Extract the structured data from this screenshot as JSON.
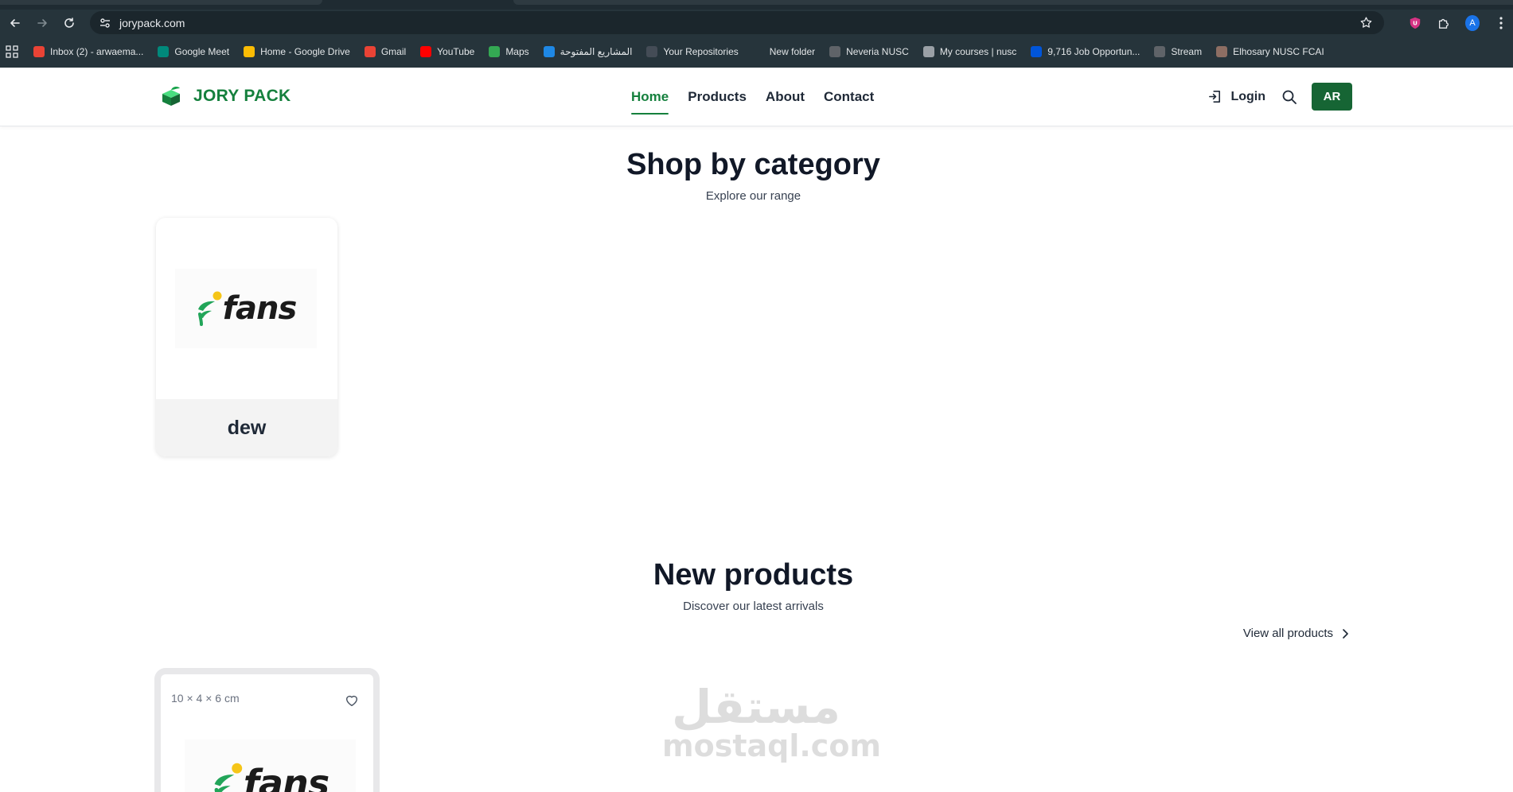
{
  "browser": {
    "url": "jorypack.com",
    "profile_initial": "A",
    "bookmarks": [
      {
        "label": "Inbox (2) - arwaema...",
        "icon": "gmail-icon",
        "color": "#ea4335"
      },
      {
        "label": "Google Meet",
        "icon": "google-meet-icon",
        "color": "#00897b"
      },
      {
        "label": "Home - Google Drive",
        "icon": "google-drive-icon",
        "color": "#fbbc04"
      },
      {
        "label": "Gmail",
        "icon": "gmail-icon",
        "color": "#ea4335"
      },
      {
        "label": "YouTube",
        "icon": "youtube-icon",
        "color": "#ff0000"
      },
      {
        "label": "Maps",
        "icon": "maps-icon",
        "color": "#34a853"
      },
      {
        "label": "المشاريع المفتوحة",
        "icon": "mostaql-icon",
        "color": "#1e88e5"
      },
      {
        "label": "Your Repositories",
        "icon": "github-icon",
        "color": "#444c56"
      },
      {
        "label": "New folder",
        "icon": "folder-icon",
        "color": "#26343b"
      },
      {
        "label": "Neveria NUSC",
        "icon": "classroom-icon",
        "color": "#5f6368"
      },
      {
        "label": "My courses | nusc",
        "icon": "moodle-icon",
        "color": "#9aa0a6"
      },
      {
        "label": "9,716 Job Opportun...",
        "icon": "wuzzuf-icon",
        "color": "#0055d9"
      },
      {
        "label": "Stream",
        "icon": "classroom-icon",
        "color": "#5f6368"
      },
      {
        "label": "Elhosary NUSC FCAI",
        "icon": "avatar-icon",
        "color": "#8d6e63"
      }
    ]
  },
  "header": {
    "brand": "JORY PACK",
    "nav": [
      {
        "label": "Home",
        "active": true
      },
      {
        "label": "Products",
        "active": false
      },
      {
        "label": "About",
        "active": false
      },
      {
        "label": "Contact",
        "active": false
      }
    ],
    "login_label": "Login",
    "lang_label": "AR"
  },
  "categories_section": {
    "title": "Shop by category",
    "subtitle": "Explore our range",
    "items": [
      {
        "name": "dew",
        "logo_text": "fans"
      }
    ]
  },
  "products_section": {
    "title": "New products",
    "subtitle": "Discover our latest arrivals",
    "view_all_label": "View all products",
    "items": [
      {
        "dimensions": "10 × 4 × 6 cm",
        "logo_text": "fans"
      }
    ]
  },
  "watermark": {
    "arabic": "مستقل",
    "latin": "mostaql.com"
  },
  "colors": {
    "brand_green": "#15803d",
    "button_green": "#166534",
    "browser_dark": "#26343b"
  }
}
